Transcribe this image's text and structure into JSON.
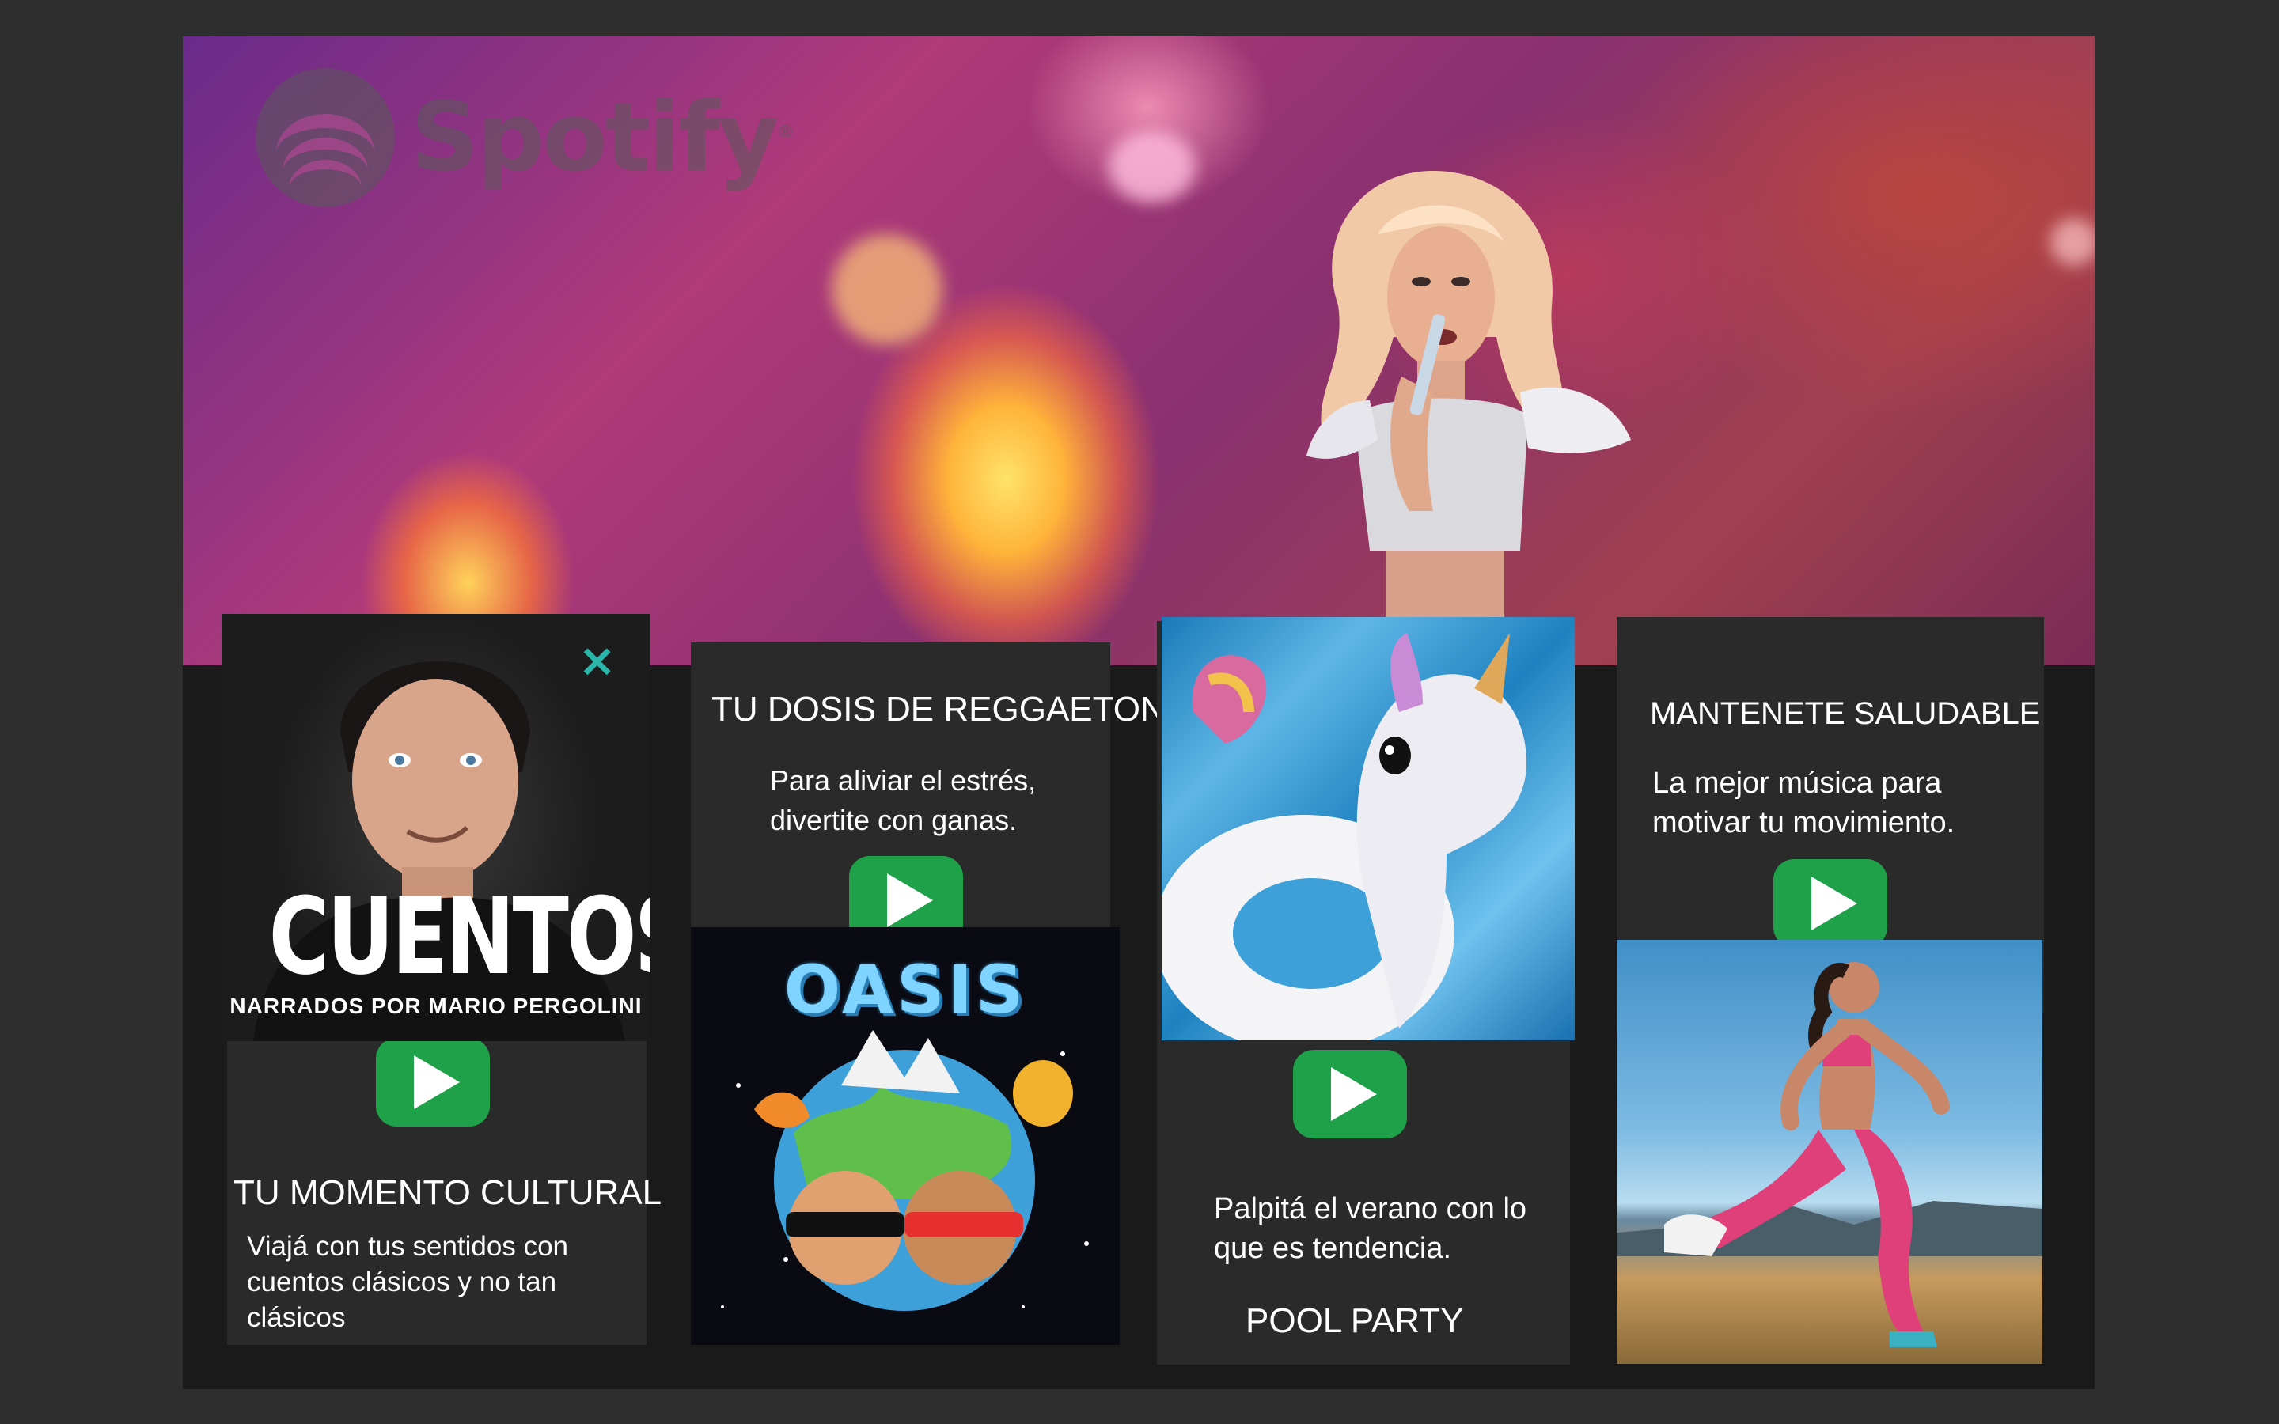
{
  "brand": {
    "name": "Spotify",
    "registered_mark": "®",
    "accent": "#1fa14a"
  },
  "cards": [
    {
      "art_title": "CUENTOS",
      "art_subtitle": "NARRADOS POR MARIO PERGOLINI",
      "art_mark": "✕",
      "title": "TU MOMENTO CULTURAL",
      "description": "Viajá con tus sentidos con cuentos clásicos y no tan clásicos",
      "action_icon": "play-icon"
    },
    {
      "title": "TU DOSIS DE REGGAETON",
      "description": "Para aliviar el estrés, divertite con ganas.",
      "art_title": "OASIS",
      "action_icon": "play-icon"
    },
    {
      "title": "POOL PARTY",
      "description": "Palpitá el verano con lo que es tendencia.",
      "action_icon": "play-icon"
    },
    {
      "title": "MANTENETE SALUDABLE",
      "description": "La mejor música para motivar tu movimiento.",
      "action_icon": "play-icon"
    }
  ]
}
